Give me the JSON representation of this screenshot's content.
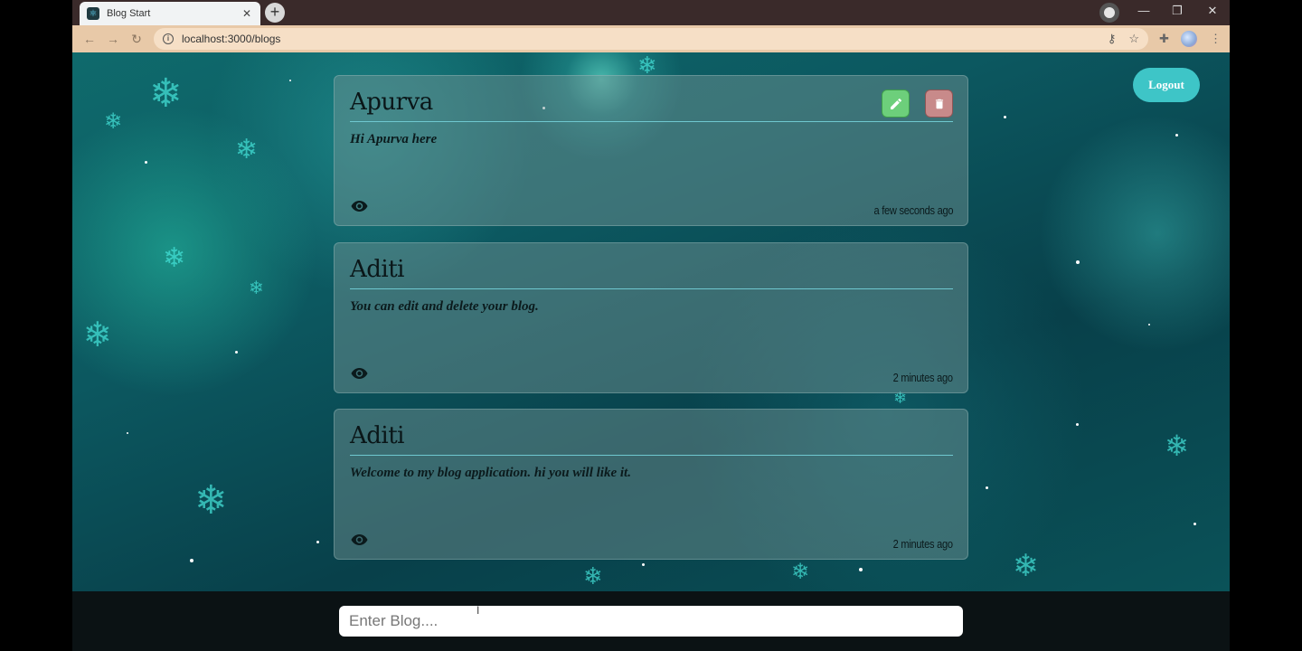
{
  "browser": {
    "tab_title": "Blog Start",
    "url": "localhost:3000/blogs"
  },
  "header": {
    "logout_label": "Logout"
  },
  "blogs": [
    {
      "author": "Apurva",
      "content": "Hi Apurva here",
      "time": "a few seconds ago",
      "editable": true
    },
    {
      "author": "Aditi",
      "content": "You can edit and delete your blog.",
      "time": "2 minutes ago",
      "editable": false
    },
    {
      "author": "Aditi",
      "content": "Welcome to my blog application. hi you will like it.",
      "time": "2 minutes ago",
      "editable": false
    }
  ],
  "composer": {
    "placeholder": "Enter Blog...."
  },
  "colors": {
    "logout_button": "#3ec5c7",
    "edit_button": "#6dcf7b",
    "delete_button": "#c88a8a",
    "card_rule": "#6fc8d0"
  },
  "icons": {
    "view": "eye-icon",
    "edit": "pencil-icon",
    "delete": "trash-icon"
  }
}
